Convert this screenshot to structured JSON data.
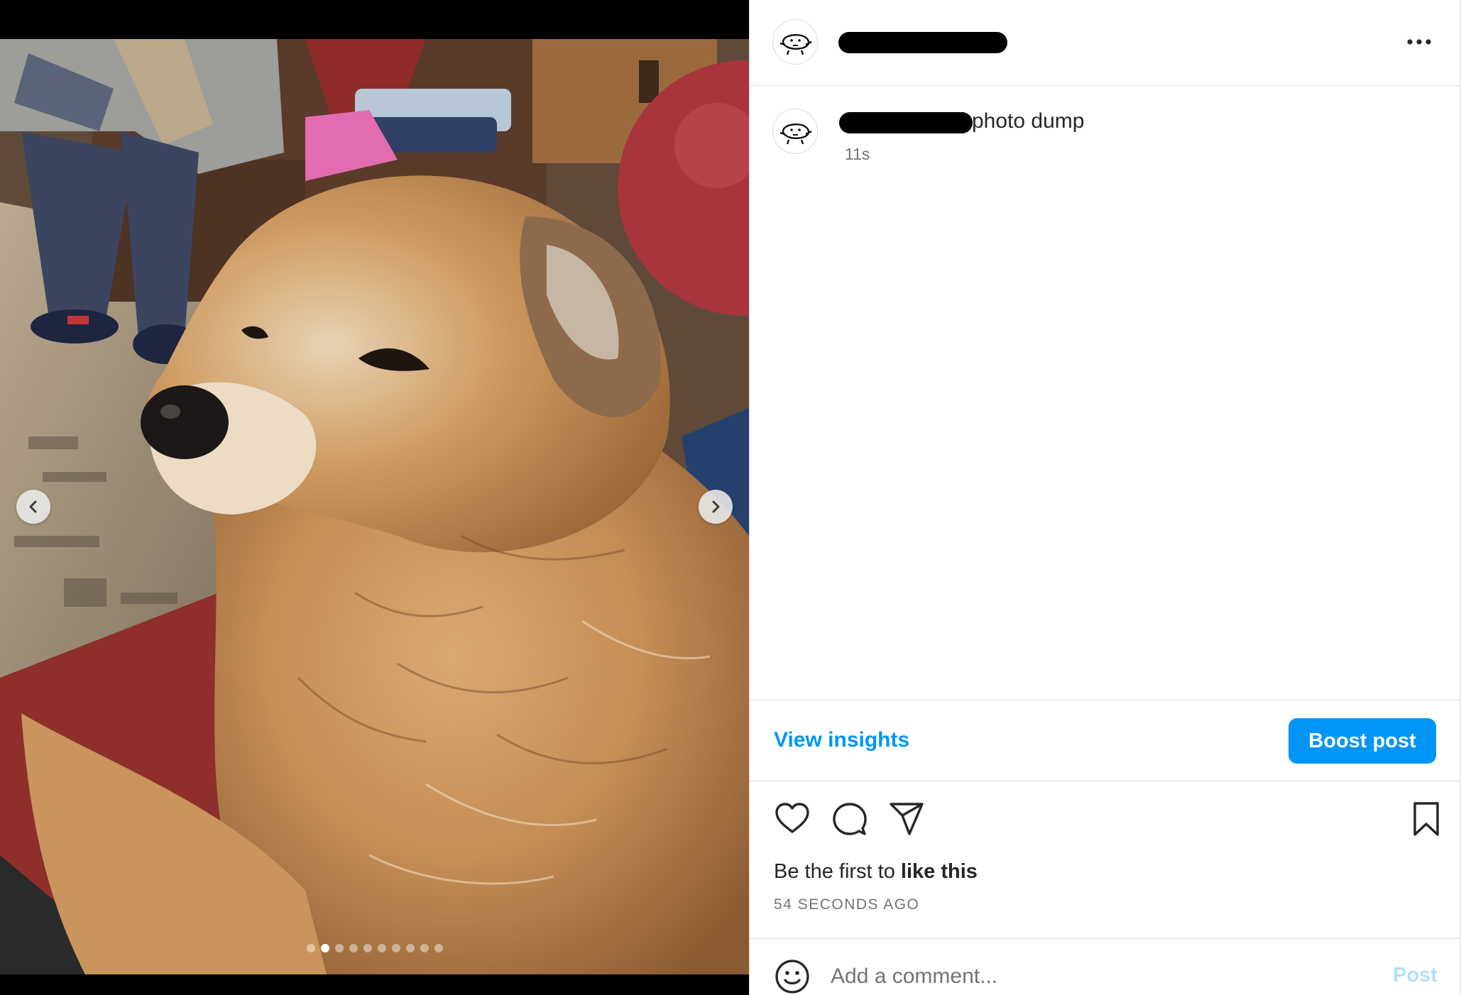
{
  "post": {
    "header": {
      "avatar_icon": "doodle-face-avatar",
      "username_redacted": true,
      "more_icon": "more-horizontal-icon"
    },
    "caption": {
      "username_redacted": true,
      "text": "photo dump",
      "time": "11s"
    },
    "carousel": {
      "total_slides": 10,
      "current_slide": 2,
      "prev_icon": "chevron-left-icon",
      "next_icon": "chevron-right-icon"
    },
    "insights": {
      "view_label": "View insights",
      "boost_label": "Boost post"
    },
    "actions": {
      "like_icon": "heart-icon",
      "comment_icon": "comment-icon",
      "share_icon": "paper-plane-icon",
      "save_icon": "bookmark-icon"
    },
    "likes": {
      "prefix": "Be the first to ",
      "emphasis": "like this"
    },
    "timestamp": "54 SECONDS AGO",
    "comment": {
      "emoji_icon": "smiley-icon",
      "placeholder": "Add a comment...",
      "post_label": "Post"
    }
  },
  "colors": {
    "accent": "#0095f6",
    "post_disabled": "#b2dffc",
    "muted_text": "#737373"
  }
}
